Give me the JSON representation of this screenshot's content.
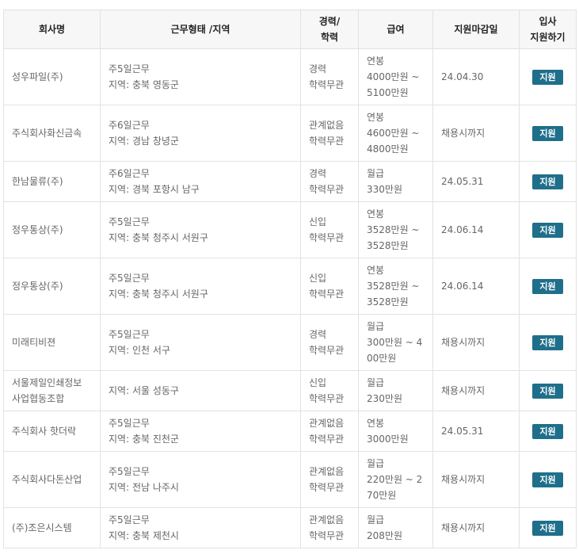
{
  "headers": {
    "company": "회사명",
    "work": "근무형태 /지역",
    "exp": [
      "경력/",
      "학력"
    ],
    "pay": "급여",
    "deadline": "지원마감일",
    "apply": [
      "입사",
      "지원하기"
    ]
  },
  "apply_label": "지원",
  "rows": [
    {
      "company": [
        "성우파일(주)"
      ],
      "work": [
        "주5일근무",
        "지역: 충북 영동군"
      ],
      "exp": [
        "경력",
        "학력무관"
      ],
      "pay": [
        "연봉",
        "4000만원 ~",
        "5100만원"
      ],
      "deadline": "24.04.30"
    },
    {
      "company": [
        "주식회사화신금속"
      ],
      "work": [
        "주6일근무",
        "지역: 경남 창녕군"
      ],
      "exp": [
        "관계없음",
        "학력무관"
      ],
      "pay": [
        "연봉",
        "4600만원 ~",
        "4800만원"
      ],
      "deadline": "채용시까지"
    },
    {
      "company": [
        "한남물류(주)"
      ],
      "work": [
        "주6일근무",
        "지역: 경북 포항시 남구"
      ],
      "exp": [
        "경력",
        "학력무관"
      ],
      "pay": [
        "월급",
        "330만원"
      ],
      "deadline": "24.05.31"
    },
    {
      "company": [
        "정우통상(주)"
      ],
      "work": [
        "주5일근무",
        "지역: 충북 청주시 서원구"
      ],
      "exp": [
        "신입",
        "학력무관"
      ],
      "pay": [
        "연봉",
        "3528만원 ~",
        "3528만원"
      ],
      "deadline": "24.06.14"
    },
    {
      "company": [
        "정우통상(주)"
      ],
      "work": [
        "주5일근무",
        "지역: 충북 청주시 서원구"
      ],
      "exp": [
        "신입",
        "학력무관"
      ],
      "pay": [
        "연봉",
        "3528만원 ~",
        "3528만원"
      ],
      "deadline": "24.06.14"
    },
    {
      "company": [
        "미래티비젼"
      ],
      "work": [
        "주5일근무",
        "지역: 인천 서구"
      ],
      "exp": [
        "경력",
        "학력무관"
      ],
      "pay": [
        "월급",
        "300만원 ~ 4",
        "00만원"
      ],
      "deadline": "채용시까지"
    },
    {
      "company": [
        "서울제일인쇄정보",
        "사업협동조합"
      ],
      "work": [
        "",
        "지역: 서울 성동구"
      ],
      "exp": [
        "신입",
        "학력무관"
      ],
      "pay": [
        "월급",
        "230만원"
      ],
      "deadline": "채용시까지"
    },
    {
      "company": [
        "주식회사 핫더락"
      ],
      "work": [
        "주5일근무",
        "지역: 충북 진천군"
      ],
      "exp": [
        "관계없음",
        "학력무관"
      ],
      "pay": [
        "연봉",
        "3000만원"
      ],
      "deadline": "24.05.31"
    },
    {
      "company": [
        "주식회사다돈산업"
      ],
      "work": [
        "주5일근무",
        "지역: 전남 나주시"
      ],
      "exp": [
        "관계없음",
        "학력무관"
      ],
      "pay": [
        "월급",
        "220만원 ~ 2",
        "70만원"
      ],
      "deadline": "채용시까지"
    },
    {
      "company": [
        "(주)조은시스템"
      ],
      "work": [
        "주5일근무",
        "지역: 충북 제천시"
      ],
      "exp": [
        "관계없음",
        "학력무관"
      ],
      "pay": [
        "월급",
        "208만원"
      ],
      "deadline": "채용시까지"
    }
  ]
}
